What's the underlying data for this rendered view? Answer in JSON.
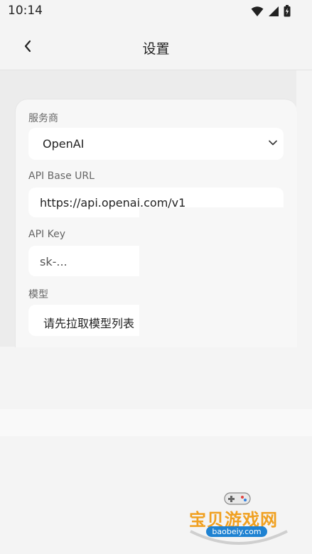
{
  "status_bar": {
    "time": "10:14"
  },
  "header": {
    "title": "设置"
  },
  "form": {
    "provider": {
      "label": "服务商",
      "value": "OpenAI"
    },
    "base_url": {
      "label": "API Base URL",
      "value": "https://api.openai.com/v1"
    },
    "api_key": {
      "label": "API Key",
      "placeholder": "sk-..."
    },
    "model": {
      "label": "模型",
      "value": "请先拉取模型列表"
    }
  },
  "watermark": {
    "name": "宝贝游戏网",
    "url": "baobeiy.com"
  },
  "colors": {
    "accent": "#f0a020",
    "watermark_badge": "#1e82d2"
  }
}
